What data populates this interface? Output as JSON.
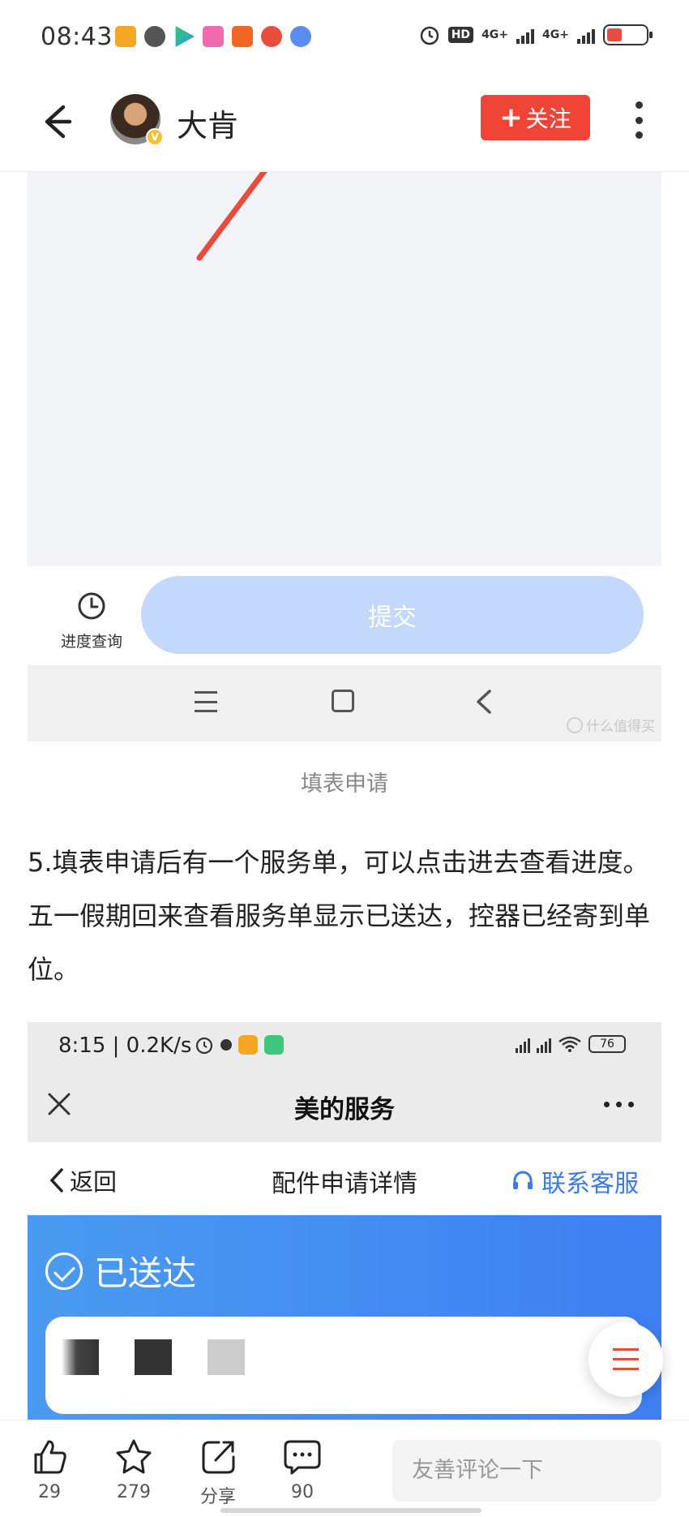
{
  "status_bar": {
    "time": "08:43",
    "network_1": "4G+",
    "network_2": "4G+",
    "hd": "HD"
  },
  "header": {
    "author_name": "大肯",
    "follow_label": "关注"
  },
  "image1": {
    "progress_label": "进度查询",
    "submit_label": "提交",
    "watermark": "什么值得买"
  },
  "caption": "填表申请",
  "paragraph": "5.填表申请后有一个服务单，可以点击进去查看进度。五一假期回来查看服务单显示已送达，控器已经寄到单位。",
  "image2": {
    "time": "8:15 | 0.2K/s",
    "battery": "76",
    "app_title": "美的服务",
    "back_label": "返回",
    "page_title": "配件申请详情",
    "service_label": "联系客服",
    "status_label": "已送达"
  },
  "bottom_bar": {
    "like_count": "29",
    "favorite_count": "279",
    "share_label": "分享",
    "comment_count": "90",
    "comment_placeholder": "友善评论一下"
  },
  "colors": {
    "accent_red": "#f04436",
    "submit_blue": "#c4d8fb",
    "link_blue": "#3b7be8"
  }
}
